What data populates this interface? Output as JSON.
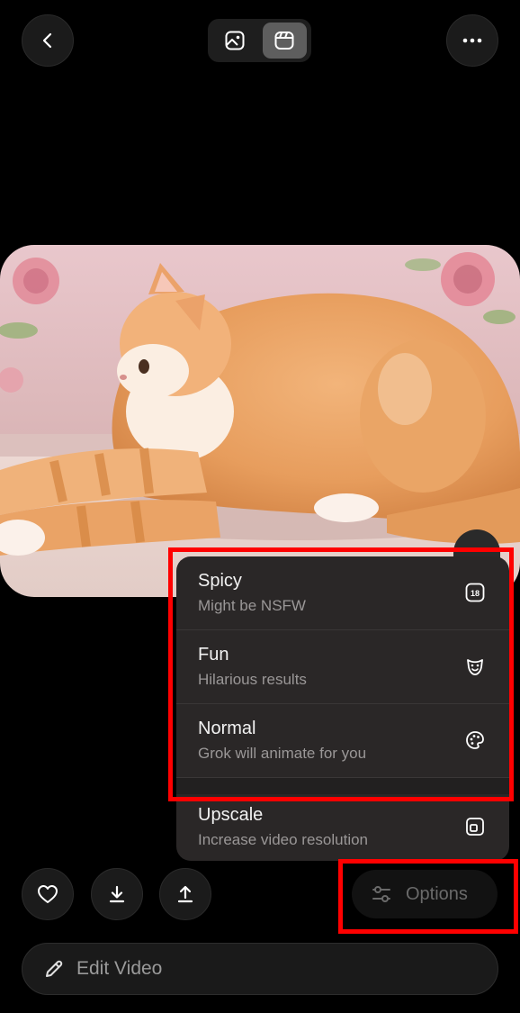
{
  "header": {
    "back_icon": "chevron-left-icon",
    "more_icon": "ellipsis-icon",
    "modes": [
      {
        "icon": "image-icon",
        "active": false
      },
      {
        "icon": "video-icon",
        "active": true
      }
    ]
  },
  "media": {
    "icon": "cat-photo"
  },
  "menu": {
    "items": [
      {
        "title": "Spicy",
        "subtitle": "Might be NSFW",
        "icon": "eighteen-plus-icon"
      },
      {
        "title": "Fun",
        "subtitle": "Hilarious results",
        "icon": "mask-icon"
      },
      {
        "title": "Normal",
        "subtitle": "Grok will animate for you",
        "icon": "palette-icon"
      },
      {
        "title": "Upscale",
        "subtitle": "Increase video resolution",
        "icon": "upscale-icon"
      }
    ]
  },
  "actions": {
    "like_icon": "heart-icon",
    "download_icon": "download-icon",
    "share_icon": "share-icon",
    "options_label": "Options",
    "options_icon": "sliders-icon"
  },
  "edit": {
    "label": "Edit Video",
    "icon": "pencil-icon"
  },
  "colors": {
    "background": "#000000",
    "menu_bg": "#2a2727",
    "highlight": "#ff0000"
  }
}
